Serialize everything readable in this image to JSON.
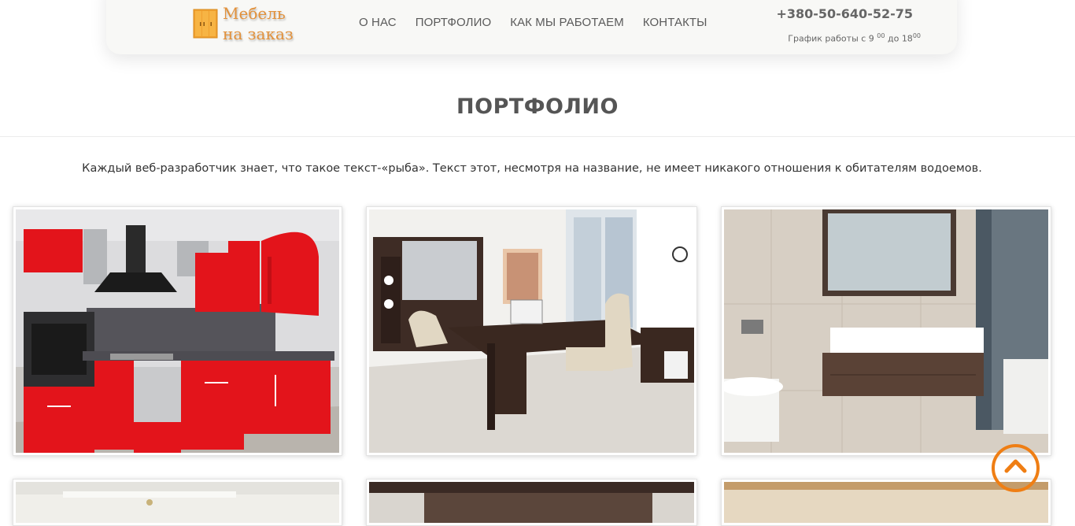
{
  "header": {
    "logo_line1": "Мебель",
    "logo_line2": "на заказ",
    "logo_icon": "wardrobe-icon",
    "nav": [
      {
        "label": "О НАС"
      },
      {
        "label": "ПОРТФОЛИО"
      },
      {
        "label": "КАК МЫ РАБОТАЕМ"
      },
      {
        "label": "КОНТАКТЫ"
      }
    ],
    "phone": "+380-50-640-52-75",
    "hours_prefix": "График работы с 9",
    "hours_sup1": "00",
    "hours_mid": " до 18",
    "hours_sup2": "00"
  },
  "portfolio": {
    "title": "ПОРТФОЛИО",
    "intro": "Каждый веб-разработчик знает, что такое текст-«рыба». Текст этот, несмотря на название, не имеет никакого отношения к обитателям водоемов."
  },
  "colors": {
    "accent": "#ef7e14",
    "logo": "#e2913b",
    "header_bg": "#f8f8f6"
  },
  "scroll_top": {
    "icon": "chevron-up-icon"
  }
}
